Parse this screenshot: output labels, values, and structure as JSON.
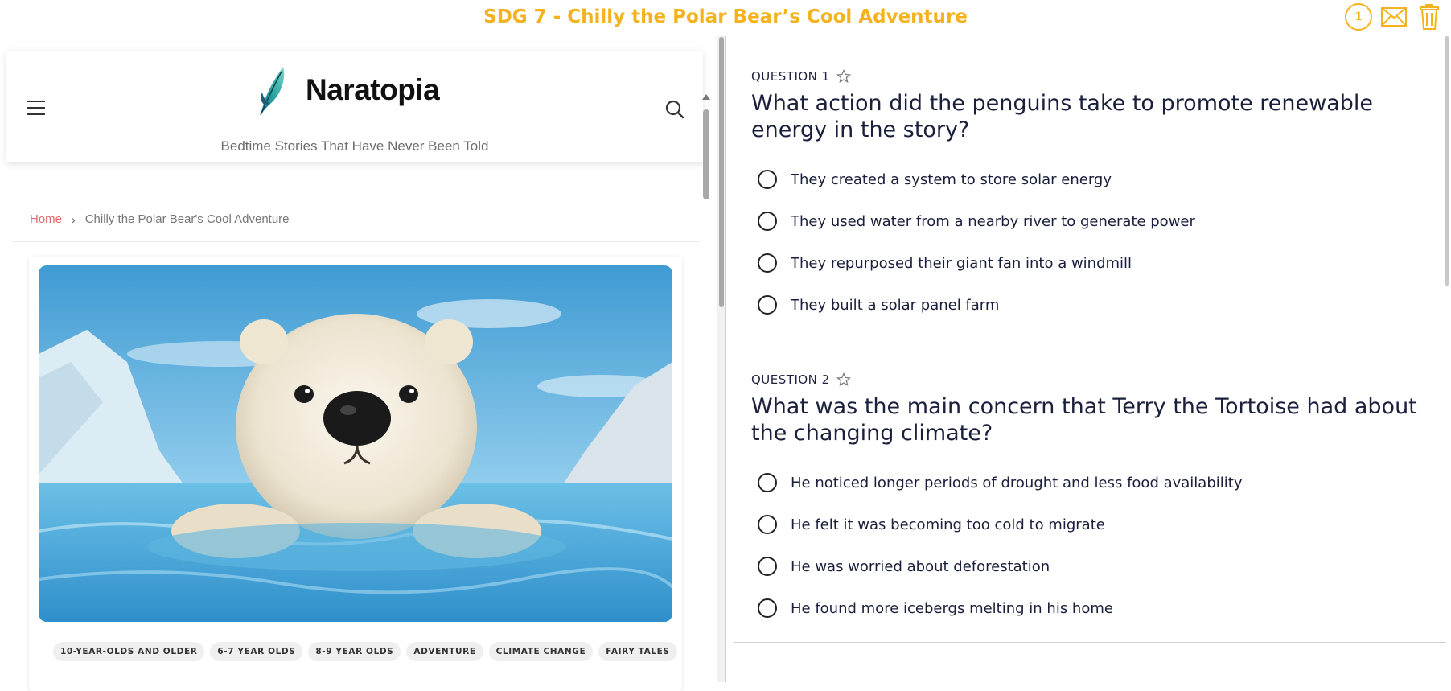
{
  "app": {
    "title": "SDG 7 - Chilly the Polar Bear’s Cool Adventure",
    "badge_count": "1"
  },
  "site": {
    "name": "Naratopia",
    "tagline": "Bedtime Stories That Have Never Been Told"
  },
  "breadcrumb": {
    "home": "Home",
    "separator": "›",
    "current": "Chilly the Polar Bear's Cool Adventure"
  },
  "tags": [
    "10-YEAR-OLDS AND OLDER",
    "6-7 YEAR OLDS",
    "8-9 YEAR OLDS",
    "ADVENTURE",
    "CLIMATE CHANGE",
    "FAIRY TALES"
  ],
  "questions": [
    {
      "label": "QUESTION 1",
      "text": "What action did the penguins take to promote renewable energy in the story?",
      "options": [
        "They created a system to store solar energy",
        "They used water from a nearby river to generate power",
        "They repurposed their giant fan into a windmill",
        "They built a solar panel farm"
      ]
    },
    {
      "label": "QUESTION 2",
      "text": "What was the main concern that Terry the Tortoise had about the changing climate?",
      "options": [
        "He noticed longer periods of drought and less food availability",
        "He felt it was becoming too cold to migrate",
        "He was worried about deforestation",
        "He found more icebergs melting in his home"
      ]
    }
  ],
  "icons": {
    "badge": "count-badge",
    "mail": "mail-icon",
    "trash": "trash-icon",
    "menu": "hamburger-icon",
    "search": "search-icon",
    "star": "star-outline-icon",
    "logo": "feather-logo-icon"
  },
  "colors": {
    "accent": "#f5b21f",
    "question_text": "#1a1f3c",
    "breadcrumb_home": "#e26a6a"
  }
}
